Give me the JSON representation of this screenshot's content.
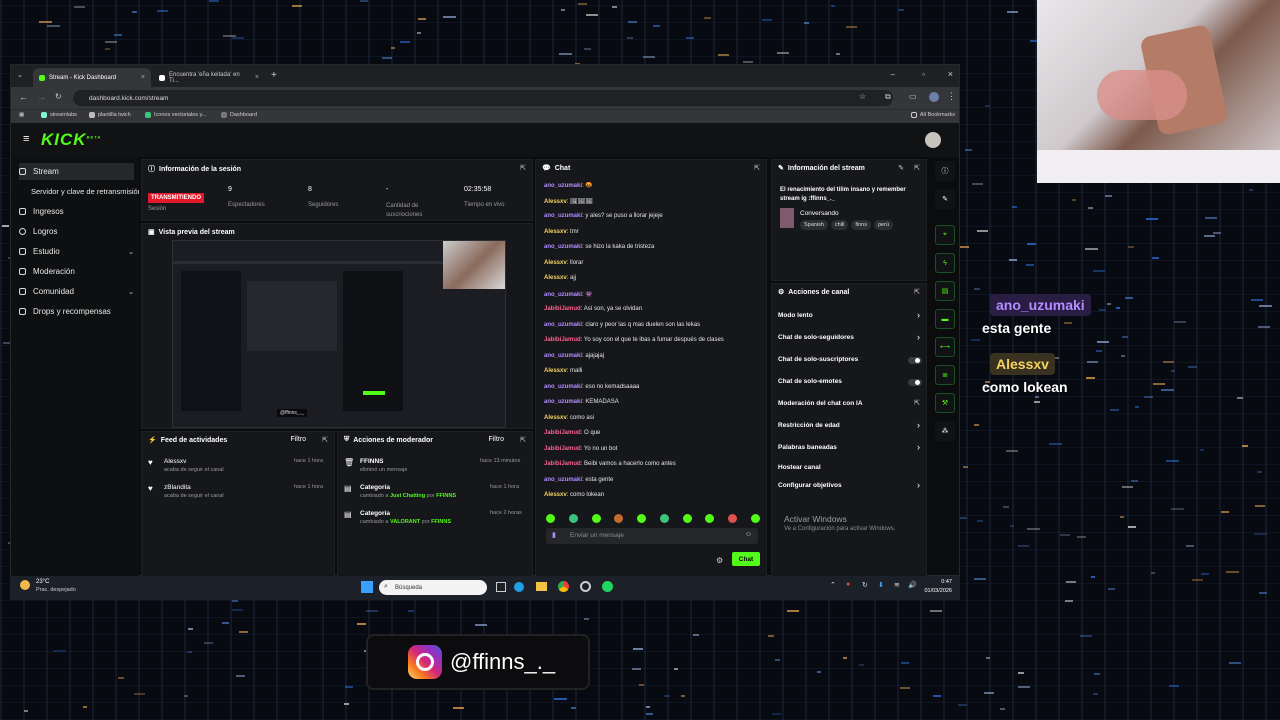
{
  "browser": {
    "tabs": [
      {
        "label": "Stream - Kick Dashboard",
        "active": true
      },
      {
        "label": "Encuentra 'eña keitada' en Ti...",
        "active": false
      }
    ],
    "url": "dashboard.kick.com/stream",
    "bookmarks": [
      "streamlabs",
      "plantilla twich",
      "Iconos vectoriales y...",
      "Dashboard"
    ],
    "all_bookmarks": "All Bookmarks"
  },
  "kick": {
    "logo": "KICK",
    "logo_sup": "BETA"
  },
  "sidebar": {
    "items": [
      {
        "label": "Stream"
      },
      {
        "label": "Servidor y clave de retransmisión"
      },
      {
        "label": "Ingresos"
      },
      {
        "label": "Logros"
      },
      {
        "label": "Estudio"
      },
      {
        "label": "Moderación"
      },
      {
        "label": "Comunidad"
      },
      {
        "label": "Drops y recompensas"
      }
    ]
  },
  "session": {
    "title": "Información de la sesión",
    "status": "TRANSMITIENDO",
    "status_label": "Sesión",
    "stats": [
      {
        "value": "9",
        "label": "Espectadores"
      },
      {
        "value": "8",
        "label": "Seguidores"
      },
      {
        "value": "-",
        "label": "Cantidad de suscriociones"
      },
      {
        "value": "02:35:58",
        "label": "Tiempo en vivo"
      }
    ],
    "preview_title": "Vista previa del stream",
    "preview_watermark": "@ffinns_._"
  },
  "activity": {
    "title": "Feed de actividades",
    "filter": "Filtro",
    "items": [
      {
        "name": "Alessxv",
        "desc": "acaba de seguir el canal",
        "time": "hace 1 hora"
      },
      {
        "name": "zBlandita",
        "desc": "acaba de seguir el canal",
        "time": "hace 1 hora"
      }
    ]
  },
  "modactions": {
    "title": "Acciones de moderador",
    "filter": "Filtro",
    "items": [
      {
        "title": "FFINNS",
        "desc": "eliminó un mensaje",
        "time": "hace 13 minutos",
        "hl": "",
        "hl2": ""
      },
      {
        "title": "Categoría",
        "desc": "cambiado a",
        "time": "hace 1 hora",
        "hl": "Just Chatting",
        "hl2": "FFINNS"
      },
      {
        "title": "Categoría",
        "desc": "cambiado a",
        "time": "hace 2 horas",
        "hl": "VALORANT",
        "hl2": "FFINNS"
      }
    ],
    "por": "por"
  },
  "chat": {
    "title": "Chat",
    "messages": [
      {
        "user": "ano_uzumaki",
        "text": "🤬",
        "color": "#b48cff"
      },
      {
        "user": "Alessxv",
        "text": "🖼🖼🖼",
        "color": "#f4d35e"
      },
      {
        "user": "ano_uzumaki",
        "text": "y ales? se puso a llorar jejeje",
        "color": "#b48cff"
      },
      {
        "user": "Alessxv",
        "text": "tmr",
        "color": "#f4d35e"
      },
      {
        "user": "ano_uzumaki",
        "text": "se hizo la kaka de tristeza",
        "color": "#b48cff"
      },
      {
        "user": "Alessxv",
        "text": "llorar",
        "color": "#f4d35e"
      },
      {
        "user": "Alessxv",
        "text": "ajj",
        "color": "#f4d35e"
      },
      {
        "user": "ano_uzumaki",
        "text": "👾",
        "color": "#b48cff"
      },
      {
        "user": "JabibiJamud",
        "text": "Así son, ya se olvidan",
        "color": "#ff5f8f"
      },
      {
        "user": "ano_uzumaki",
        "text": "claro y peor las q mas duelen son las lekas",
        "color": "#b48cff"
      },
      {
        "user": "JabibiJamud",
        "text": "Yo soy con el que te ibas a fumar después de clases",
        "color": "#ff5f8f"
      },
      {
        "user": "ano_uzumaki",
        "text": "ajajajaj",
        "color": "#b48cff"
      },
      {
        "user": "Alessxv",
        "text": "malli",
        "color": "#f4d35e"
      },
      {
        "user": "ano_uzumaki",
        "text": "eso no kemadsaaaa",
        "color": "#b48cff"
      },
      {
        "user": "ano_uzumaki",
        "text": "KEMADASA",
        "color": "#b48cff"
      },
      {
        "user": "Alessxv",
        "text": "como asi",
        "color": "#f4d35e"
      },
      {
        "user": "JabibiJamud",
        "text": "O que",
        "color": "#ff5f8f"
      },
      {
        "user": "JabibiJamud",
        "text": "Yo no un bot",
        "color": "#ff5f8f"
      },
      {
        "user": "JabibiJamud",
        "text": "Beibi vamos a hacerlo como antes",
        "color": "#ff5f8f"
      },
      {
        "user": "ano_uzumaki",
        "text": "esta gente",
        "color": "#b48cff"
      },
      {
        "user": "Alessxv",
        "text": "como lokean",
        "color": "#f4d35e"
      }
    ],
    "placeholder": "Enviar un mensaje",
    "send": "Chat"
  },
  "streaminfo": {
    "title": "Información del stream",
    "stream_title": "El renacimiento del tilim insano y remember stream ig :ffinns_._",
    "category": "Conversando",
    "tags": [
      "Spanish",
      "chill",
      "finns",
      "perú"
    ]
  },
  "channel": {
    "title": "Acciones de canal",
    "items": [
      {
        "label": "Modo lento",
        "ctrl": "arrow"
      },
      {
        "label": "Chat de solo-seguidores",
        "ctrl": "arrow"
      },
      {
        "label": "Chat de solo-suscriptores",
        "ctrl": "toggle"
      },
      {
        "label": "Chat de solo-emotes",
        "ctrl": "toggle"
      },
      {
        "label": "Moderación del chat con IA",
        "ctrl": "ext"
      },
      {
        "label": "Restricción de edad",
        "ctrl": "arrow"
      },
      {
        "label": "Palabras baneadas",
        "ctrl": "arrow"
      },
      {
        "label": "Hostear canal",
        "ctrl": "none"
      },
      {
        "label": "Configurar objetivos",
        "ctrl": "arrow"
      }
    ],
    "activate_title": "Activar Windows",
    "activate_sub": "Ve a Configuración para activar Windows."
  },
  "taskbar": {
    "weather_temp": "23°C",
    "weather_desc": "Prac. despejado",
    "search": "Búsqueda",
    "time": "0:47",
    "date": "01/03/2026"
  },
  "overlay": {
    "chat": [
      {
        "user": "ano_uzumaki",
        "text": "esta gente",
        "color": "#b48cff"
      },
      {
        "user": "Alessxv",
        "text": "como lokean",
        "color": "#f4d35e"
      }
    ],
    "instagram": "@ffinns_._"
  },
  "colors": {
    "kick_green": "#53fc18",
    "live_red": "#e1192b"
  }
}
